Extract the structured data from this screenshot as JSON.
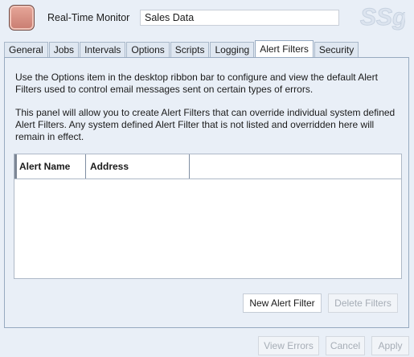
{
  "header": {
    "app_label": "Real-Time Monitor",
    "name_value": "Sales Data",
    "watermark": "SSg"
  },
  "tabs": [
    {
      "label": "General"
    },
    {
      "label": "Jobs"
    },
    {
      "label": "Intervals"
    },
    {
      "label": "Options"
    },
    {
      "label": "Scripts"
    },
    {
      "label": "Logging"
    },
    {
      "label": "Alert Filters",
      "active": true
    },
    {
      "label": "Security"
    }
  ],
  "panel": {
    "description_1": "Use the Options item in the desktop ribbon bar to configure and view the default Alert Filters used to control email messages sent on certain types of errors.",
    "description_2": "This panel will allow you to create Alert Filters that can override individual system defined Alert Filters. Any system defined Alert Filter that is not listed and overridden here will remain in effect.",
    "grid": {
      "columns": [
        "Alert Name",
        "Address"
      ],
      "rows": []
    },
    "new_filter_label": "New Alert Filter",
    "delete_filters_label": "Delete Filters"
  },
  "footer": {
    "view_errors_label": "View Errors",
    "cancel_label": "Cancel",
    "apply_label": "Apply"
  },
  "colors": {
    "background": "#e9eff7",
    "tab_inactive": "#dfe7f1",
    "tab_active": "#ffffff",
    "border": "#97aac0"
  }
}
